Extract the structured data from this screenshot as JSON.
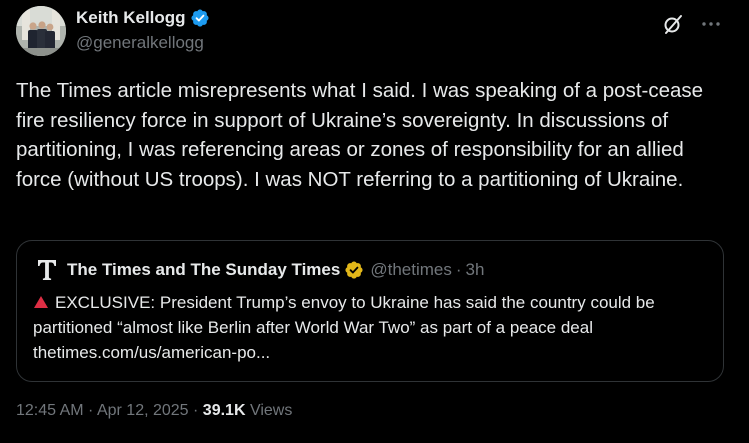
{
  "author": {
    "name": "Keith Kellogg",
    "handle": "@generalkellogg",
    "avatar_icon": "profile-photo",
    "verified_icon": "verified-badge-icon",
    "verified_color": "#1d9bf0"
  },
  "header_actions": {
    "grok_icon": "grok-icon",
    "more_icon": "more-horizontal-icon"
  },
  "tweet": {
    "text": "The Times article misrepresents what I said. I was speaking of a post-cease fire resiliency force in support of Ukraine’s sovereignty. In discussions of partitioning, I was referencing areas or zones of responsibility for an allied force (without US troops). I was NOT referring to a partitioning of Ukraine."
  },
  "quote": {
    "logo_icon": "the-times-logo-icon",
    "name": "The Times and The Sunday Times",
    "badge_icon": "gold-verified-badge-icon",
    "badge_color": "#e2b719",
    "handle": "@thetimes",
    "separator": "·",
    "time": "3h",
    "warning_icon": "red-triangle-icon",
    "warning_color": "#dd2e44",
    "text": "EXCLUSIVE: President Trump’s envoy to Ukraine has said the country could be partitioned “almost like Berlin after World War Two” as part of a peace deal thetimes.com/us/american-po..."
  },
  "meta": {
    "time": "12:45 AM",
    "separator1": " · ",
    "date": "Apr 12, 2025",
    "separator2": " · ",
    "views_count": "39.1K",
    "views_label": " Views"
  },
  "colors": {
    "background": "#000000",
    "text_primary": "#e7e9ea",
    "text_secondary": "#71767b",
    "border": "#2f3336"
  }
}
